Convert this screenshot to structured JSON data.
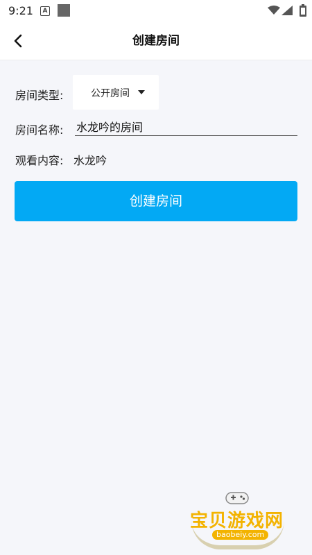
{
  "status": {
    "time": "9:21",
    "notification_letter": "A"
  },
  "header": {
    "title": "创建房间"
  },
  "form": {
    "room_type_label": "房间类型:",
    "room_type_value": "公开房间",
    "room_name_label": "房间名称:",
    "room_name_value": "水龙吟的房间",
    "watch_content_label": "观看内容:",
    "watch_content_value": "水龙吟"
  },
  "actions": {
    "create_label": "创建房间"
  },
  "watermark": {
    "text": "宝贝游戏网",
    "url": "baobeiy.com"
  },
  "colors": {
    "accent": "#03a9f4",
    "background": "#f5f6fa",
    "watermark": "#f3b300"
  }
}
